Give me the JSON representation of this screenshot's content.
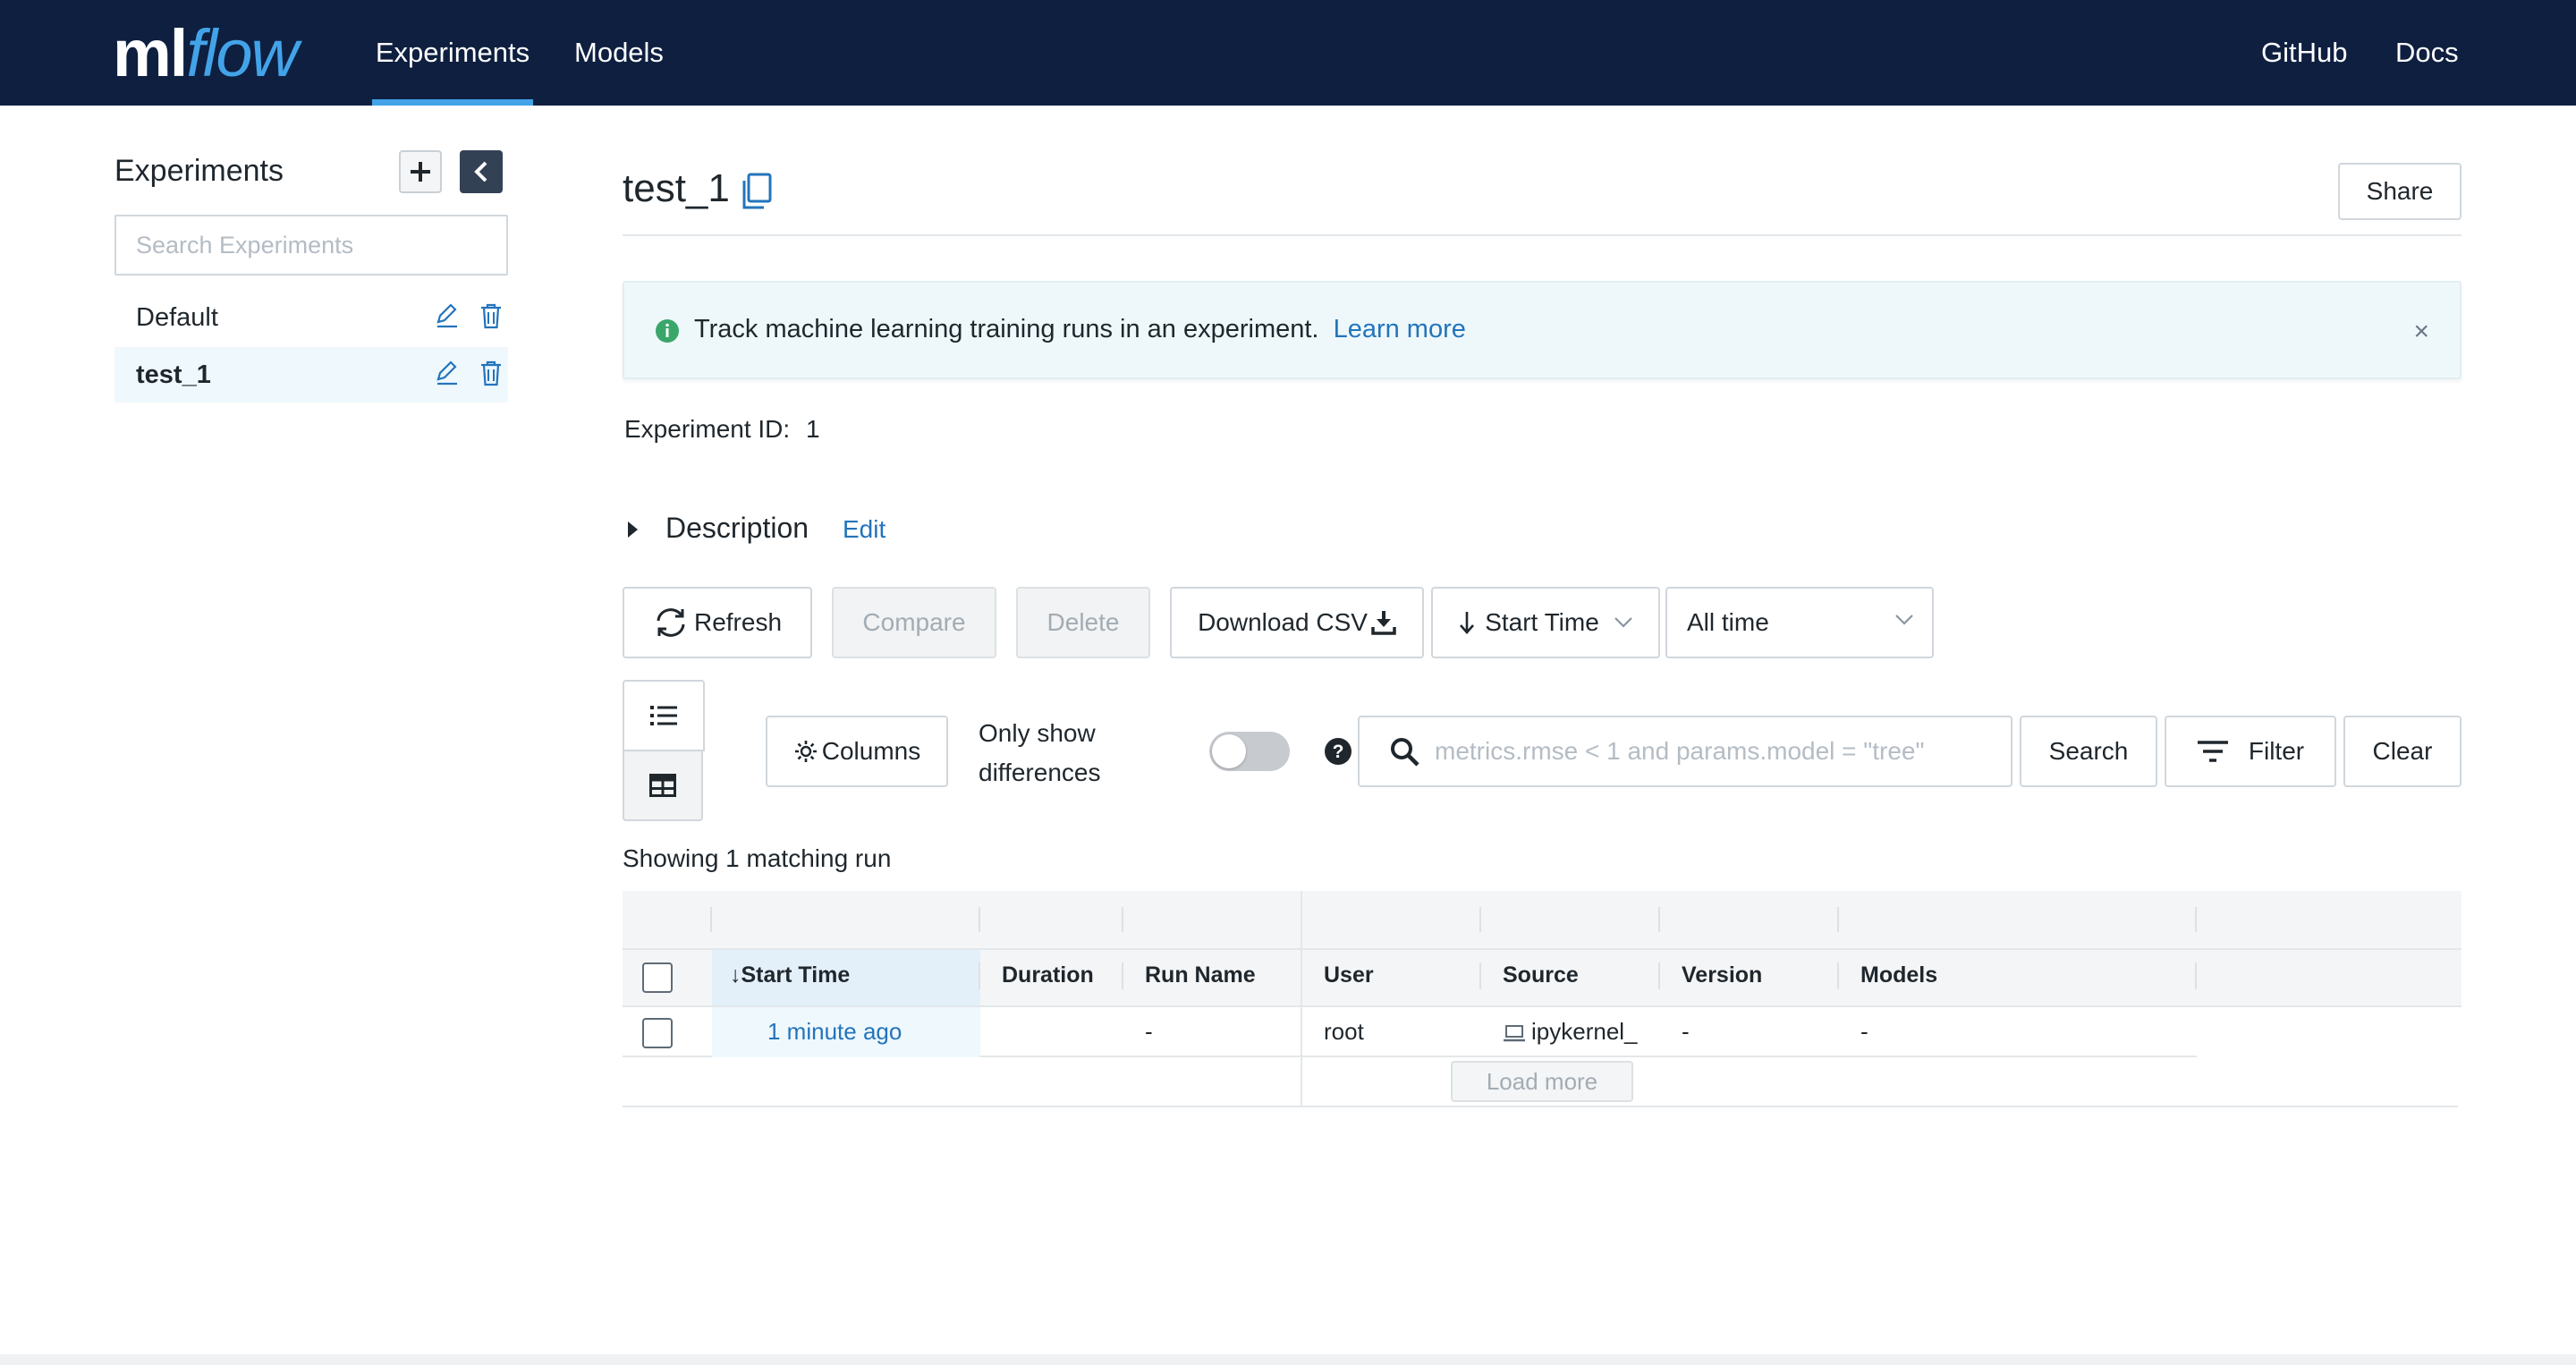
{
  "header": {
    "logo_ml": "ml",
    "logo_flow": "flow",
    "tabs": [
      {
        "label": "Experiments",
        "active": true
      },
      {
        "label": "Models",
        "active": false
      }
    ],
    "links": [
      {
        "label": "GitHub"
      },
      {
        "label": "Docs"
      }
    ]
  },
  "sidebar": {
    "title": "Experiments",
    "add_icon": "plus-icon",
    "collapse_icon": "chevron-left-icon",
    "search_placeholder": "Search Experiments",
    "experiments": [
      {
        "name": "Default",
        "active": false
      },
      {
        "name": "test_1",
        "active": true
      }
    ]
  },
  "main": {
    "title": "test_1",
    "share_label": "Share",
    "banner": {
      "text": "Track machine learning training runs in an experiment.",
      "link": "Learn more",
      "close": "×"
    },
    "experiment_id_label": "Experiment ID:",
    "experiment_id": "1",
    "description_label": "Description",
    "description_edit": "Edit",
    "toolbar": {
      "refresh": "Refresh",
      "compare": "Compare",
      "delete": "Delete",
      "download_csv": "Download CSV",
      "sort_label": "Start Time",
      "time_range": "All time",
      "columns": "Columns",
      "only_show_diff_line1": "Only show",
      "only_show_diff_line2": "differences",
      "search_placeholder": "metrics.rmse < 1 and params.model = \"tree\"",
      "search": "Search",
      "filter": "Filter",
      "clear": "Clear"
    },
    "match_count": "Showing 1 matching run",
    "table": {
      "columns": [
        "Start Time",
        "Duration",
        "Run Name",
        "User",
        "Source",
        "Version",
        "Models"
      ],
      "rows": [
        {
          "start_time": "1 minute ago",
          "duration": "",
          "run_name": "-",
          "user": "root",
          "source": "ipykernel_",
          "version": "-",
          "models": "-"
        }
      ],
      "load_more": "Load more"
    }
  },
  "colors": {
    "header_bg": "#0e1f40",
    "accent": "#43a3e8",
    "link": "#2374bb",
    "banner_bg": "#eef8fb"
  }
}
